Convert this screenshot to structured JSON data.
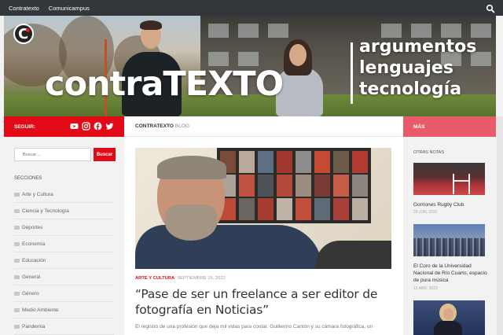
{
  "topnav": {
    "items": [
      "Contratexto",
      "Comunicampus"
    ],
    "search_icon": "search-icon"
  },
  "banner": {
    "wordmark_left": "contra",
    "wordmark_right": "TEXTO",
    "tags": [
      "argumentos",
      "lenguajes",
      "tecnología"
    ]
  },
  "left_sidebar": {
    "follow_label": "SEGUIR:",
    "social_icons": [
      "youtube-icon",
      "instagram-icon",
      "facebook-icon",
      "twitter-icon"
    ],
    "search_placeholder": "Buscar ...",
    "search_button": "Buscar",
    "sections_title": "SECCIONES",
    "categories": [
      "Arte y Cultura",
      "Ciencia y Tecnología",
      "Deportes",
      "Economía",
      "Educación",
      "General",
      "Género",
      "Medio Ambiente",
      "Pandemia"
    ]
  },
  "main": {
    "breadcrumb_bold": "CONTRATEXTO",
    "breadcrumb_rest": "BLOG",
    "post": {
      "category": "ARTE Y CULTURA",
      "date": "SEPTIEMBRE 15, 2022",
      "title": "“Pase de ser un freelance a ser editor de fotografía en Noticias”",
      "excerpt": "El registro de una profesión que deja mil vidas para contar. Guillermo Cantón y su cámara fotográfica, un"
    }
  },
  "right_sidebar": {
    "more_label": "MÁS",
    "other_notes_title": "OTRAS NOTAS",
    "notes": [
      {
        "title": "Gorriones Rugby Club",
        "date": "28 JUN, 2022"
      },
      {
        "title": "El Coro de la Universidad Nacional de Río Cuarto, espacio de pura música",
        "date": "12 ABR, 2022"
      },
      {
        "title": "",
        "date": ""
      }
    ]
  },
  "colors": {
    "brand_red": "#e10a16",
    "more_pink": "#e95b6a",
    "topbar": "#33363b"
  }
}
